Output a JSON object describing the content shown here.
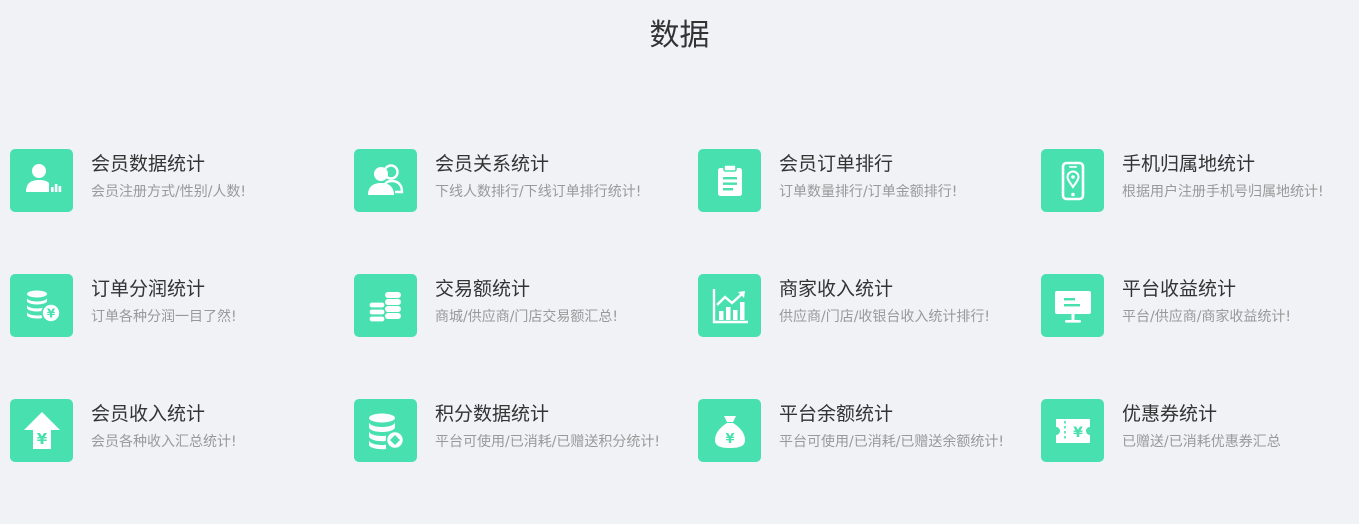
{
  "header": {
    "title": "数据"
  },
  "theme": {
    "accent": "#48e0af",
    "background": "#f1f2f6",
    "title_color": "#333333",
    "desc_color": "#999999"
  },
  "cards": [
    {
      "title": "会员数据统计",
      "desc": "会员注册方式/性别/人数!",
      "icon": "member-chart-icon"
    },
    {
      "title": "会员关系统计",
      "desc": "下线人数排行/下线订单排行统计!",
      "icon": "users-group-icon"
    },
    {
      "title": "会员订单排行",
      "desc": "订单数量排行/订单金额排行!",
      "icon": "clipboard-icon"
    },
    {
      "title": "手机归属地统计",
      "desc": "根据用户注册手机号归属地统计!",
      "icon": "phone-location-icon"
    },
    {
      "title": "订单分润统计",
      "desc": "订单各种分润一目了然!",
      "icon": "coins-yuan-icon"
    },
    {
      "title": "交易额统计",
      "desc": "商城/供应商/门店交易额汇总!",
      "icon": "coin-stacks-icon"
    },
    {
      "title": "商家收入统计",
      "desc": "供应商/门店/收银台收入统计排行!",
      "icon": "bar-chart-trend-icon"
    },
    {
      "title": "平台收益统计",
      "desc": "平台/供应商/商家收益统计!",
      "icon": "monitor-icon"
    },
    {
      "title": "会员收入统计",
      "desc": "会员各种收入汇总统计!",
      "icon": "upload-yuan-icon"
    },
    {
      "title": "积分数据统计",
      "desc": "平台可使用/已消耗/已赠送积分统计!",
      "icon": "points-database-icon"
    },
    {
      "title": "平台余额统计",
      "desc": "平台可使用/已消耗/已赠送余额统计!",
      "icon": "money-bag-icon"
    },
    {
      "title": "优惠券统计",
      "desc": "已赠送/已消耗优惠券汇总",
      "icon": "coupon-ticket-icon"
    }
  ]
}
